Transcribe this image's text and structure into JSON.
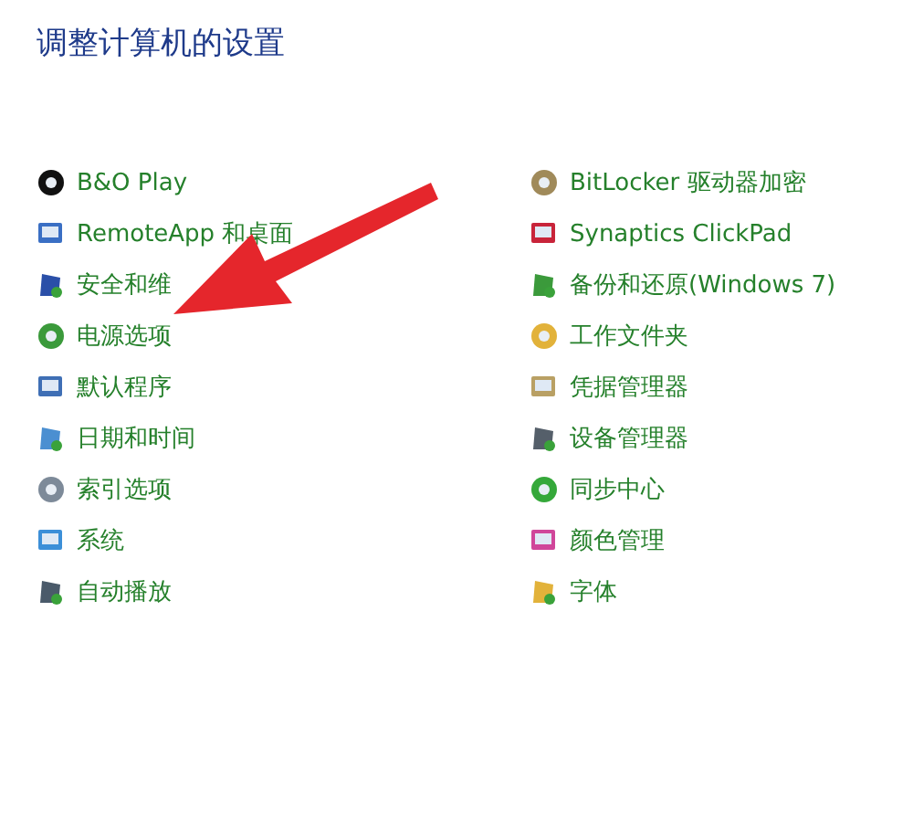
{
  "title": "调整计算机的设置",
  "columns": [
    [
      "B&O Play",
      "RemoteApp 和桌面",
      "安全和维",
      "电源选项",
      "默认程序",
      "日期和时间",
      "索引选项",
      "系统",
      "自动播放"
    ],
    [
      "BitLocker 驱动器加密",
      "Synaptics ClickPad",
      "备份和还原(Windows 7)",
      "工作文件夹",
      "凭据管理器",
      "设备管理器",
      "同步中心",
      "颜色管理",
      "字体"
    ]
  ]
}
